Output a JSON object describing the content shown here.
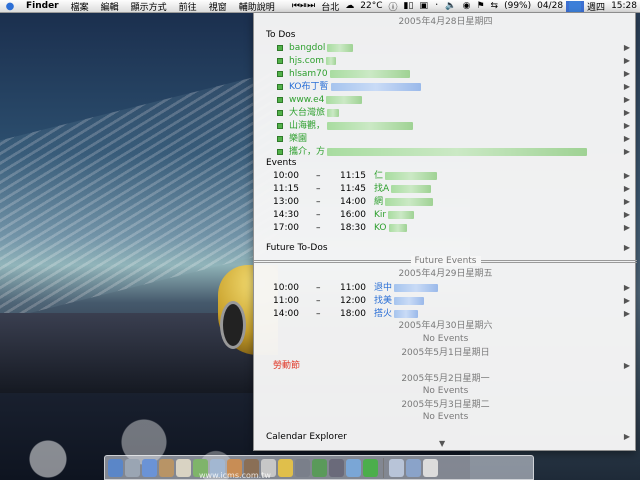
{
  "menubar": {
    "apple": "",
    "items": [
      "Finder",
      "檔案",
      "編輯",
      "顯示方式",
      "前往",
      "視窗",
      "輔助說明"
    ],
    "weather": "台北",
    "temp": "22°C",
    "battery": "(99%)",
    "date": "04/28",
    "weekday": "週四",
    "time": "15:28"
  },
  "panel": {
    "today_header": "2005年4月28日星期四",
    "todos_header": "To Dos",
    "todos": [
      {
        "text": "bangdol",
        "color": "green",
        "blur": 26
      },
      {
        "text": "hjs.com",
        "color": "green",
        "blur": 10
      },
      {
        "text": "hlsam70",
        "color": "green",
        "blur": 80
      },
      {
        "text": "KO布丁暫",
        "color": "blue",
        "blur": 90
      },
      {
        "text": "www.e4",
        "color": "green",
        "blur": 36
      },
      {
        "text": "大台灣旅",
        "color": "green",
        "blur": 12
      },
      {
        "text": "山海觀，",
        "color": "green",
        "blur": 86
      },
      {
        "text": "樂園",
        "color": "green",
        "blur": 0
      },
      {
        "text": "攜介，方",
        "color": "green",
        "blur": 260
      }
    ],
    "events_header": "Events",
    "events": [
      {
        "start": "10:00",
        "end": "11:15",
        "title": "仁",
        "color": "green",
        "blur": 52
      },
      {
        "start": "11:15",
        "end": "11:45",
        "title": "找A",
        "color": "green",
        "blur": 40
      },
      {
        "start": "13:00",
        "end": "14:00",
        "title": "網",
        "color": "green",
        "blur": 48
      },
      {
        "start": "14:30",
        "end": "16:00",
        "title": "Kir",
        "color": "green",
        "blur": 26
      },
      {
        "start": "17:00",
        "end": "18:30",
        "title": "KO",
        "color": "green",
        "blur": 18
      }
    ],
    "dash": "–",
    "future_todos": "Future To-Dos",
    "future_events": "Future Events",
    "day2_header": "2005年4月29日星期五",
    "day2_events": [
      {
        "start": "10:00",
        "end": "11:00",
        "title": "退中",
        "color": "blue",
        "blur": 44
      },
      {
        "start": "11:00",
        "end": "12:00",
        "title": "找美",
        "color": "blue",
        "blur": 30
      },
      {
        "start": "14:00",
        "end": "18:00",
        "title": "搭火",
        "color": "blue",
        "blur": 24
      }
    ],
    "day3_header": "2005年4月30日星期六",
    "no_events": "No Events",
    "day4_header": "2005年5月1日星期日",
    "holiday": "勞動節",
    "day5_header": "2005年5月2日星期一",
    "day6_header": "2005年5月3日星期二",
    "calendar_explorer": "Calendar Explorer"
  },
  "watermark": "www.icms.com.tw",
  "colors": {
    "green": "#2fa02f",
    "blue": "#2a6fd6",
    "holiday": "#e03a2a"
  }
}
